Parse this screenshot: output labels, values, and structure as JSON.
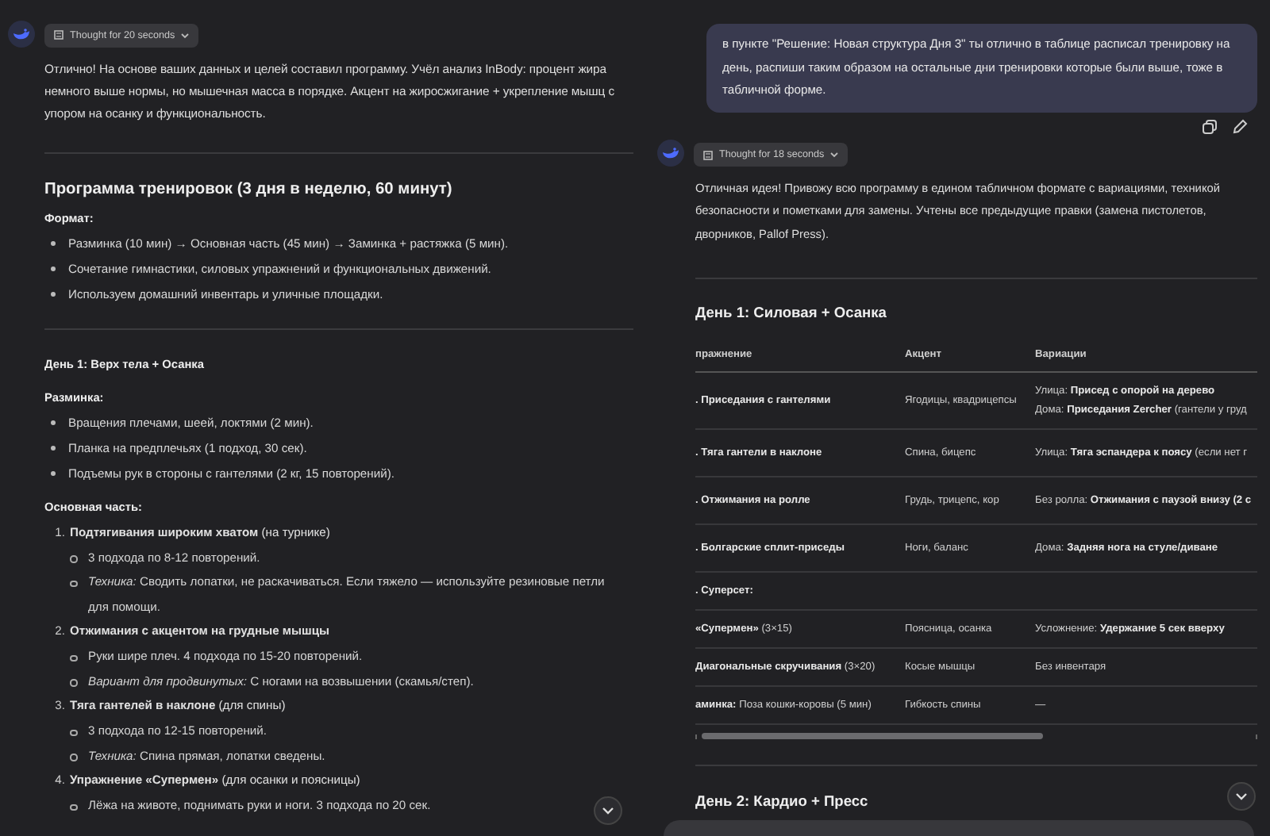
{
  "left_chat": {
    "thought_chip": "Thought for 20 seconds",
    "intro": "Отлично! На основе ваших данных и целей составил программу. Учёл анализ InBody: процент жира немного выше нормы, но мышечная масса в порядке. Акцент на жиросжигание + укрепление мышц с упором на осанку и функциональность.",
    "heading": "Программа тренировок (3 дня в неделю, 60 минут)",
    "format_label": "Формат:",
    "format_items": [
      "Разминка (10 мин) → Основная часть (45 мин) → Заминка + растяжка (5 мин).",
      "Сочетание гимнастики, силовых упражнений и функциональных движений.",
      "Используем домашний инвентарь и уличные площадки."
    ],
    "day_heading": "День 1: Верх тела + Осанка",
    "warmup_label": "Разминка:",
    "warmup_items": [
      "Вращения плечами, шеей, локтями (2 мин).",
      "Планка на предплечьях (1 подход, 30 сек).",
      "Подъемы рук в стороны с гантелями (2 кг, 15 повторений)."
    ],
    "main_label": "Основная часть:",
    "exercises": [
      {
        "number": "1.",
        "title": "**Подтягивания широким хватом** (на турнике)",
        "details": [
          "3 подхода по 8-12 повторений.",
          "*Техника:* Сводить лопатки, не раскачиваться. Если тяжело — используйте резиновые петли для помощи."
        ]
      },
      {
        "number": "2.",
        "title": "**Отжимания с акцентом на грудные мышцы**",
        "details": [
          "Руки шире плеч. 4 подхода по 15-20 повторений.",
          "*Вариант для продвинутых:* С ногами на возвышении (скамья/степ)."
        ]
      },
      {
        "number": "3.",
        "title": "**Тяга гантелей в наклоне** (для спины)",
        "details": [
          "3 подхода по 12-15 повторений.",
          "*Техника:* Спина прямая, лопатки сведены."
        ]
      },
      {
        "number": "4.",
        "title": "**Упражнение «Супермен»** (для осанки и поясницы)",
        "details": [
          "Лёжа на животе, поднимать руки и ноги. 3 подхода по 20 сек."
        ]
      }
    ]
  },
  "right_chat": {
    "user_message": "в пункте \"Решение: Новая структура Дня 3\" ты отлично в таблице расписал тренировку на день, распиши таким образом на остальные дни тренировки которые были выше, тоже в табличной форме.",
    "thought_chip": "Thought for 18 seconds",
    "intro": "Отличная идея! Привожу всю программу в едином табличном формате с вариациями, техникой безопасности и пометками для замены. Учтены все предыдущие правки (замена пистолетов, дворников, Pallof Press).",
    "day1_heading": "День 1: Силовая + Осанка",
    "table": {
      "columns": [
        "пражнение",
        "Акцент",
        "Вариации"
      ],
      "rows": [
        {
          "kind": "exercise",
          "exercise": "**. Приседания с гантелями**",
          "focus": "Ягодицы, квадрицепсы",
          "variations": [
            "Улица: **Присед с опорой на дерево**",
            "Дома: **Приседания Zercher** (гантели у груд"
          ]
        },
        {
          "kind": "exercise",
          "exercise": "**. Тяга гантели в наклоне**",
          "focus": "Спина, бицепс",
          "variations": [
            "Улица: **Тяга эспандера к поясу** (если нет г"
          ]
        },
        {
          "kind": "exercise",
          "exercise": "**. Отжимания на ролле**",
          "focus": "Грудь, трицепс, кор",
          "variations": [
            "Без ролла: **Отжимания с паузой внизу (2 с**"
          ]
        },
        {
          "kind": "exercise",
          "exercise": "**. Болгарские сплит-приседы**",
          "focus": "Ноги, баланс",
          "variations": [
            "Дома: **Задняя нога на стуле/диване**"
          ]
        },
        {
          "kind": "group",
          "exercise": "**. Суперсет:**"
        },
        {
          "kind": "exercise",
          "exercise": "**«Супермен»** (3×15)",
          "focus": "Поясница, осанка",
          "variations": [
            "Усложнение: **Удержание 5 сек вверху**"
          ]
        },
        {
          "kind": "exercise",
          "exercise": "**Диагональные скручивания** (3×20)",
          "focus": "Косые мышцы",
          "variations": [
            "Без инвентаря"
          ]
        },
        {
          "kind": "exercise",
          "exercise": "**аминка:** Поза кошки-коровы (5 мин)",
          "focus": "Гибкость спины",
          "variations": [
            "—"
          ]
        }
      ]
    },
    "day2_heading": "День 2: Кардио + Пресс"
  }
}
